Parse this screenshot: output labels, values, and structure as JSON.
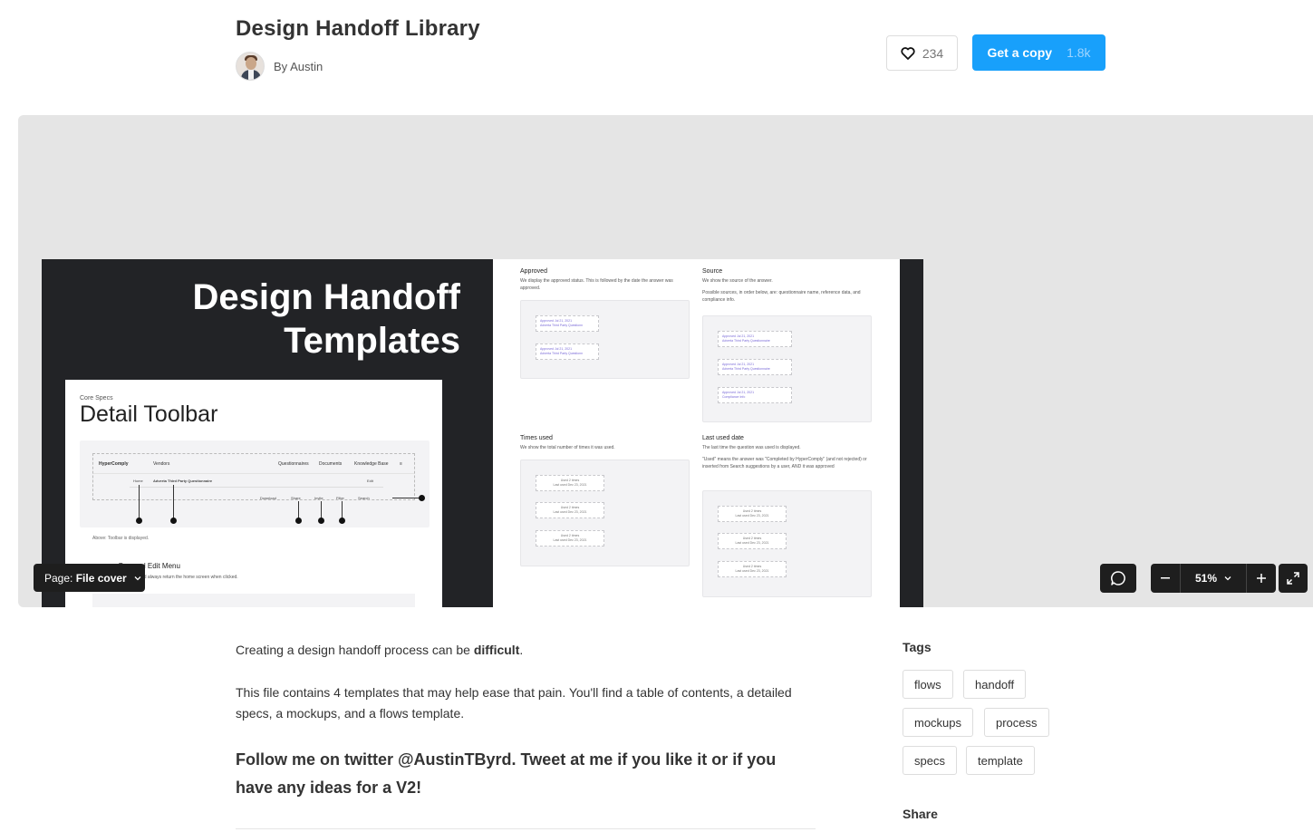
{
  "file": {
    "title": "Design Handoff Library",
    "author": "By Austin",
    "likes": "234",
    "copy_label": "Get a copy",
    "copy_count": "1.8k"
  },
  "preview": {
    "hero_title_line1": "Design Handoff",
    "hero_title_line2": "Templates",
    "spec_kicker": "Core Specs",
    "spec_title": "Detail Toolbar",
    "mock_brand": "HyperComply",
    "mock_vendors": "Vendors",
    "mock_nav": [
      "Questionnaires",
      "Documents",
      "Knowledge Base"
    ],
    "mock_breadcrumb": "Home",
    "mock_breadcrumb_item": "Adverta Third Party Questionnaire",
    "mock_edit": "Edit",
    "mock_actions": [
      "Download",
      "Share",
      "Invite",
      "Filter",
      "Search"
    ],
    "spec_caption": "Above: Toolbar is displayed.",
    "spec_sub": "rogress Bar, and Edit Menu",
    "spec_sub2": "ize text buttons and should always return the home screen when clicked.",
    "sections": {
      "approved": {
        "title": "Approved",
        "text": "We display the approved status. This is followed by the date the answer was approved.",
        "items": [
          {
            "line1": "Approved Jul 21, 2021",
            "line2": "Adverta Third Party Questionn"
          },
          {
            "line1": "Approved Jul 21, 2021",
            "line2": "Adverta Third Party Questionn"
          }
        ]
      },
      "source": {
        "title": "Source",
        "text": "We show the source of the answer.",
        "text2": "Possible sources, in order below, are: questionnaire name, reference data, and compliance info.",
        "items": [
          {
            "line1": "Approved Jul 21, 2021",
            "line2": "Adverta Third Party Questionnaire"
          },
          {
            "line1": "Approved Jul 21, 2021",
            "line2": "Adverta Third Party Questionnaire"
          },
          {
            "line1": "Approved Jul 21, 2021",
            "line2": "Compliance Info"
          }
        ]
      },
      "times_used": {
        "title": "Times used",
        "text": "We show the total number of times it was used.",
        "items": [
          {
            "line1": "Used 2 times",
            "line2": "Last used Dec 23, 2021"
          },
          {
            "line1": "Used 2 times",
            "line2": "Last used Dec 23, 2021"
          },
          {
            "line1": "Used 2 times",
            "line2": "Last used Dec 23, 2021"
          }
        ]
      },
      "last_used": {
        "title": "Last used date",
        "text": "The last time the question was used is displayed.",
        "text2": "\"Used\" means the answer was \"Completed by HyperComply\" (and not rejected) or inserted from Search suggestions by a user, AND it was approved",
        "items": [
          {
            "line1": "Used 2 times",
            "line2": "Last used Dec 23, 2021"
          },
          {
            "line1": "Used 2 times",
            "line2": "Last used Dec 23, 2021"
          },
          {
            "line1": "Used 2 times",
            "line2": "Last used Dec 23, 2021"
          }
        ]
      }
    },
    "page_prefix": "Page:",
    "page_name": "File cover",
    "zoom": "51%"
  },
  "description": {
    "line1_prefix": "Creating a design handoff process can be ",
    "line1_bold": "difficult",
    "line1_suffix": ".",
    "para2": "This file contains 4 templates that may help ease that pain. You'll find a table of contents, a detailed specs, a mockups, and a flows template.",
    "follow": "Follow me on twitter @AustinTByrd. Tweet at me if you like it or if you have any ideas for a V2!"
  },
  "sidebar": {
    "tags_heading": "Tags",
    "tags": [
      "flows",
      "handoff",
      "mockups",
      "process",
      "specs",
      "template"
    ],
    "share_heading": "Share"
  },
  "colors": {
    "accent": "#18a0fb",
    "dark_frame": "#222326",
    "canvas_bg": "#e5e5e5"
  },
  "icons": [
    "heart-icon",
    "chevron-down-icon",
    "comment-icon",
    "minus-icon",
    "plus-icon",
    "expand-icon"
  ]
}
